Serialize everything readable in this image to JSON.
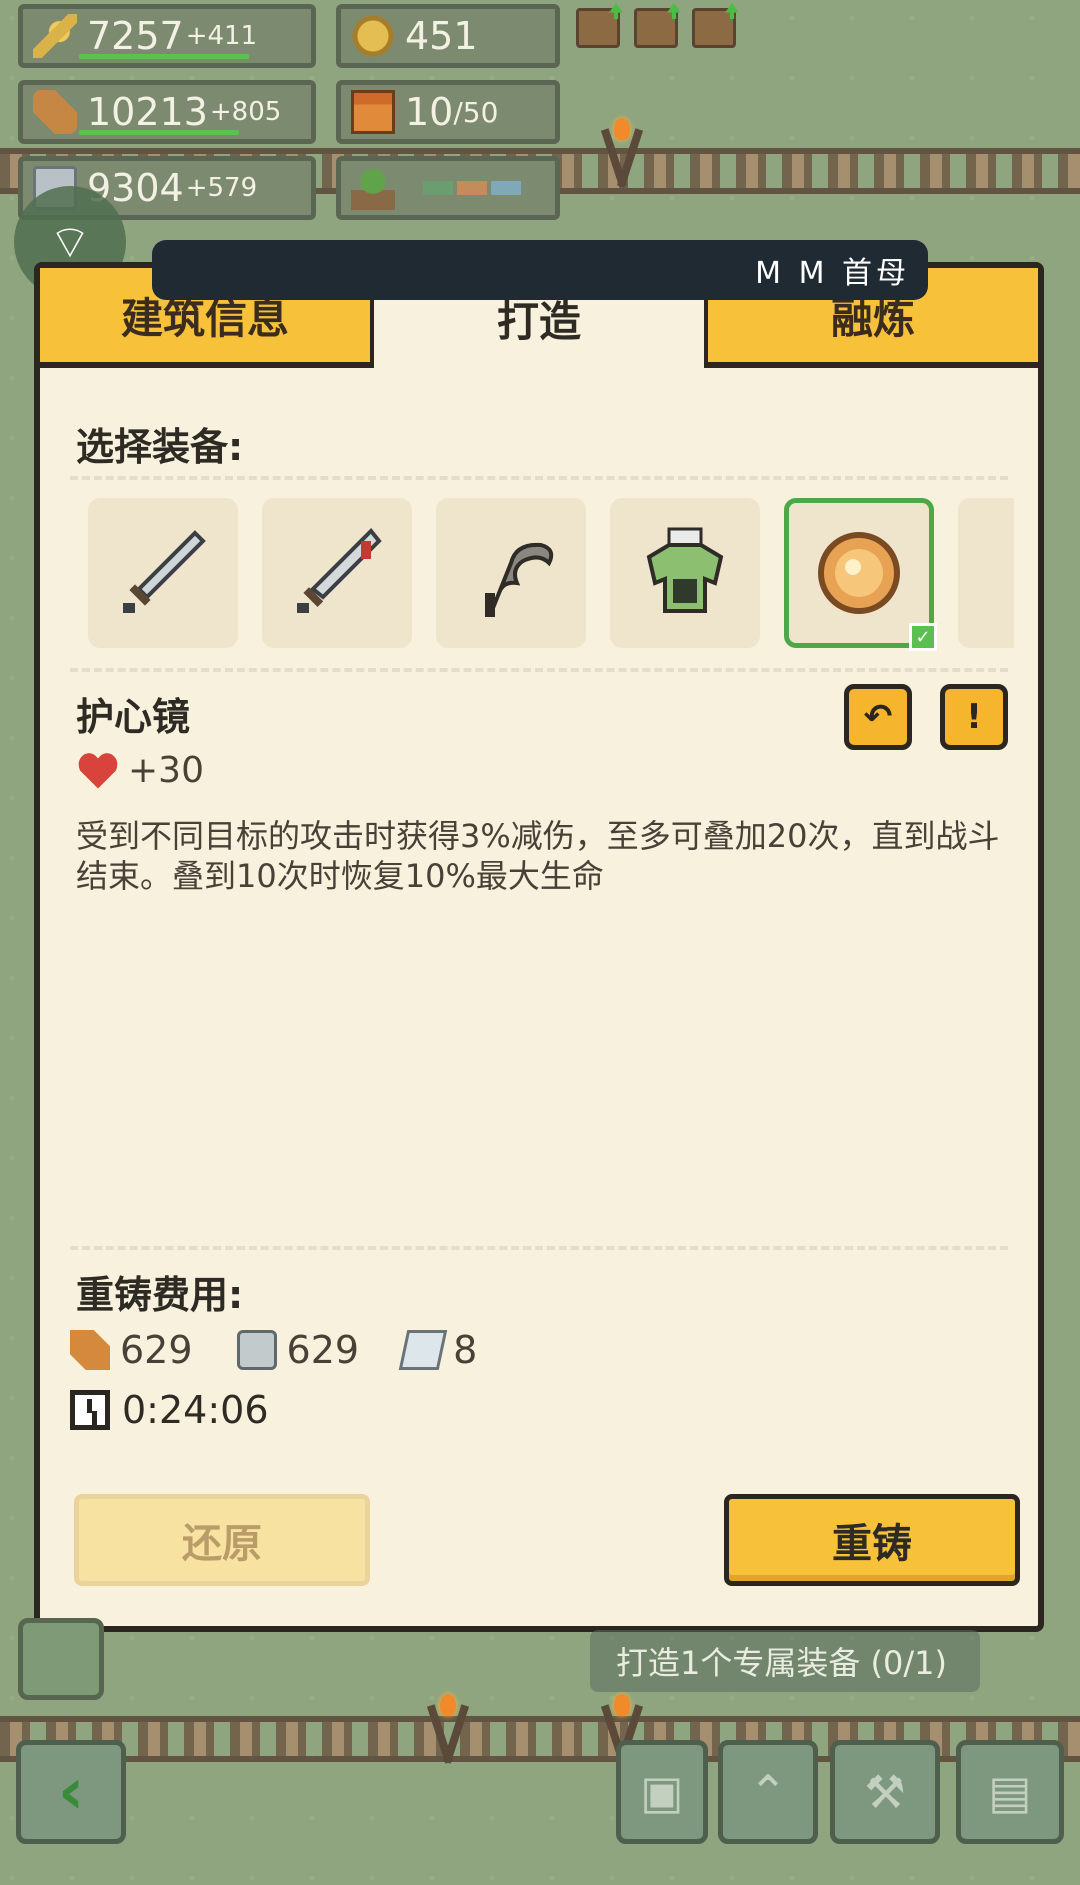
{
  "resources": {
    "food": {
      "value": "7257",
      "delta": "+411"
    },
    "coins": {
      "value": "451"
    },
    "wood": {
      "value": "10213",
      "delta": "+805"
    },
    "gifts": {
      "value": "10",
      "max": "/50"
    },
    "stone": {
      "value": "9304",
      "delta": "+579"
    }
  },
  "ticker": {
    "text": "M M 首⺟"
  },
  "tabs": [
    {
      "label": "建筑信息"
    },
    {
      "label": "打造"
    },
    {
      "label": "融炼"
    }
  ],
  "select_label": "选择装备:",
  "item": {
    "name": "护心镜",
    "stat_value": "+30",
    "description": "受到不同目标的攻击时获得3%减伤，至多可叠加20次，直到战斗结束。叠到10次时恢复10%最大生命"
  },
  "cost": {
    "label": "重铸费用:",
    "wood": "629",
    "stone": "629",
    "iron": "8",
    "time": "0:24:06"
  },
  "buttons": {
    "restore": "还原",
    "recast": "重铸"
  },
  "task": {
    "text": "打造1个专属装备 (0/1)"
  },
  "colors": {
    "panel_bg": "#f8f1dd",
    "tab_yellow": "#f7c23a",
    "selected_border": "#4ea84a",
    "grass": "#8fa57f"
  },
  "icons": {
    "slots": [
      "sword-icon",
      "bloody-sword-icon",
      "scythe-icon",
      "armor-icon",
      "mirror-icon"
    ],
    "nav": [
      "armor-nav-icon",
      "rank-icon",
      "hammer-icon",
      "book-icon"
    ]
  }
}
